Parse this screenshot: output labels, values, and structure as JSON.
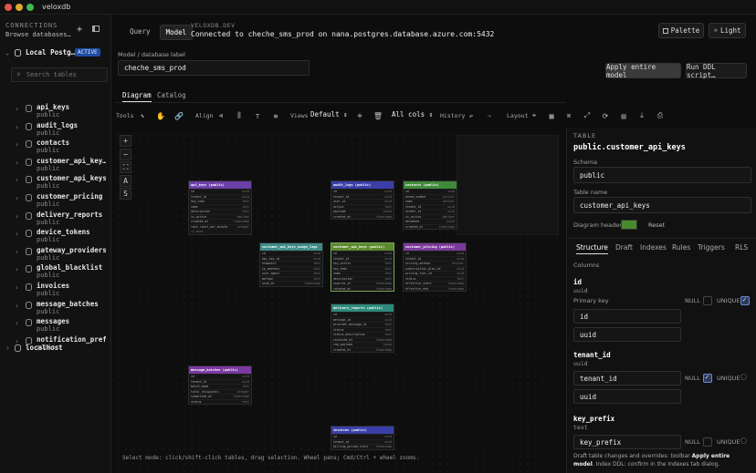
{
  "app": {
    "title": "veloxdb"
  },
  "sidebar": {
    "section_label": "CONNECTIONS",
    "browse_label": "Browse databases…",
    "connection_name": "Local Postg…",
    "connection_badge": "ACTIVE",
    "search_placeholder": "Search tables",
    "tables": [
      {
        "name": "api_keys",
        "schema": "public"
      },
      {
        "name": "audit_logs",
        "schema": "public"
      },
      {
        "name": "contacts",
        "schema": "public"
      },
      {
        "name": "customer_api_key…",
        "schema": "public"
      },
      {
        "name": "customer_api_keys",
        "schema": "public"
      },
      {
        "name": "customer_pricing",
        "schema": "public"
      },
      {
        "name": "delivery_reports",
        "schema": "public"
      },
      {
        "name": "device_tokens",
        "schema": "public"
      },
      {
        "name": "gateway_providers",
        "schema": "public"
      },
      {
        "name": "global_blacklist",
        "schema": "public"
      },
      {
        "name": "invoices",
        "schema": "public"
      },
      {
        "name": "message_batches",
        "schema": "public"
      },
      {
        "name": "messages",
        "schema": "public"
      },
      {
        "name": "notification_pref…",
        "schema": "public"
      }
    ],
    "localhost_label": "localhost"
  },
  "header": {
    "tab_query": "Query",
    "tab_model": "Model",
    "brand": "VELOXDB.DEV",
    "connection_text": "Connected to cheche_sms_prod on nana.postgres.database.azure.com:5432",
    "palette_label": "Palette",
    "theme_label": "Light"
  },
  "model": {
    "field_label": "Model / database label",
    "field_value": "cheche_sms_prod",
    "apply_label": "Apply entire model",
    "run_ddl_label": "Run DDL script…",
    "tab_diagram": "Diagram",
    "tab_catalog": "Catalog"
  },
  "toolbar": {
    "tools_label": "Tools",
    "align_label": "Align",
    "views_label": "Views",
    "views_value": "Default",
    "cols_value": "All cols",
    "history_label": "History",
    "layout_label": "Layout"
  },
  "canvas": {
    "status_text": "Select mode: click/shift-click tables, drag selection. Wheel pans; Cmd/Ctrl + wheel zooms.",
    "zoom_buttons": [
      "+",
      "−",
      "⛶",
      "A",
      "S"
    ],
    "tables": [
      {
        "title": "api_keys (public)",
        "color": "#6b3fa8",
        "rows": [
          [
            "id",
            "uuid"
          ],
          [
            "tenant_id",
            "uuid"
          ],
          [
            "key_hash",
            "text"
          ],
          [
            "name",
            "text"
          ],
          [
            "description",
            "text"
          ],
          [
            "is_active",
            "boolean"
          ],
          [
            "created_at",
            "timestamp"
          ],
          [
            "rate_limit_per_minute",
            "integer"
          ]
        ],
        "foot": "+1 more"
      },
      {
        "title": "audit_logs (public)",
        "color": "#3a3fa8",
        "rows": [
          [
            "id",
            "uuid"
          ],
          [
            "tenant_id",
            "uuid"
          ],
          [
            "user_id",
            "uuid"
          ],
          [
            "action",
            "text"
          ],
          [
            "payload",
            "jsonb"
          ],
          [
            "created_at",
            "timestamp"
          ]
        ]
      },
      {
        "title": "contacts (public)",
        "color": "#3f8a3a",
        "rows": [
          [
            "id",
            "uuid"
          ],
          [
            "phone_number",
            "varchar"
          ],
          [
            "name",
            "varchar"
          ],
          [
            "tenant_id",
            "uuid"
          ],
          [
            "sender_id",
            "uuid"
          ],
          [
            "is_active",
            "boolean"
          ],
          [
            "metadata",
            "jsonb"
          ],
          [
            "created_at",
            "timestamp"
          ]
        ]
      },
      {
        "title": "customer_api_keys_usage_logs",
        "color": "#3f8c8a",
        "rows": [
          [
            "id",
            "uuid"
          ],
          [
            "api_key_id",
            "uuid"
          ],
          [
            "endpoint",
            "text"
          ],
          [
            "ip_address",
            "text"
          ],
          [
            "user_agent",
            "text"
          ],
          [
            "method",
            "text"
          ],
          [
            "used_at",
            "timestamp"
          ]
        ]
      },
      {
        "title": "customer_api_keys (public)",
        "color": "#5a8a2e",
        "rows": [
          [
            "id",
            "uuid"
          ],
          [
            "tenant_id",
            "uuid"
          ],
          [
            "key_prefix",
            "text"
          ],
          [
            "key_hash",
            "text"
          ],
          [
            "name",
            "text"
          ],
          [
            "description",
            "text"
          ],
          [
            "expires_at",
            "timestamp"
          ],
          [
            "rotated_at",
            "timestamp"
          ]
        ]
      },
      {
        "title": "customer_pricing (public)",
        "color": "#7a3a9a",
        "rows": [
          [
            "id",
            "uuid"
          ],
          [
            "tenant_id",
            "uuid"
          ],
          [
            "pricing_method",
            "varchar"
          ],
          [
            "subscription_plan_id",
            "uuid"
          ],
          [
            "pricing_tier_id",
            "uuid"
          ],
          [
            "status",
            "text"
          ],
          [
            "effective_start",
            "timestamp"
          ],
          [
            "effective_end",
            "timestamp"
          ]
        ]
      },
      {
        "title": "delivery_reports (public)",
        "color": "#2e8a7a",
        "rows": [
          [
            "id",
            "uuid"
          ],
          [
            "message_id",
            "uuid"
          ],
          [
            "provider_message_id",
            "text"
          ],
          [
            "status",
            "text"
          ],
          [
            "status_description",
            "text"
          ],
          [
            "received_at",
            "timestamp"
          ],
          [
            "raw_payload",
            "jsonb"
          ],
          [
            "created_at",
            "timestamp"
          ]
        ]
      },
      {
        "title": "message_batches (public)",
        "color": "#7a3aa0",
        "rows": [
          [
            "id",
            "uuid"
          ],
          [
            "tenant_id",
            "uuid"
          ],
          [
            "batch_name",
            "text"
          ],
          [
            "total_recipients",
            "integer"
          ],
          [
            "submitted_at",
            "timestamp"
          ],
          [
            "status",
            "text"
          ]
        ]
      },
      {
        "title": "invoices (public)",
        "color": "#3a3fa8",
        "rows": [
          [
            "id",
            "uuid"
          ],
          [
            "tenant_id",
            "uuid"
          ],
          [
            "billing_period_start",
            "timestamp"
          ]
        ]
      }
    ]
  },
  "panel": {
    "kind": "TABLE",
    "table_name": "public.customer_api_keys",
    "schema_label": "Schema",
    "schema_value": "public",
    "table_name_label": "Table name",
    "table_name_value": "customer_api_keys",
    "diagram_header_label": "Diagram header",
    "diagram_header_color": "#4a8a2e",
    "reset_label": "Reset",
    "tabs": [
      "Structure",
      "Draft",
      "Indexes",
      "Rules",
      "Triggers",
      "RLS"
    ],
    "columns_label": "Columns",
    "columns": [
      {
        "name": "id",
        "type": "uuid",
        "note": "Primary key",
        "value": "id",
        "type_value": "uuid",
        "null_label": "NULL",
        "unique_label": "UNIQUE"
      },
      {
        "name": "tenant_id",
        "type": "uuid",
        "note": "",
        "value": "tenant_id",
        "type_value": "uuid",
        "null_label": "NULL",
        "unique_label": "UNIQUE"
      },
      {
        "name": "key_prefix",
        "type": "text",
        "note": "",
        "value": "key_prefix",
        "type_value": "",
        "null_label": "NULL",
        "unique_label": "UNIQUE"
      }
    ],
    "footer_note_1": "Draft table changes and overrides: toolbar ",
    "footer_note_bold": "Apply entire model",
    "footer_note_2": ". Index DDL: confirm in the Indexes tab dialog."
  }
}
